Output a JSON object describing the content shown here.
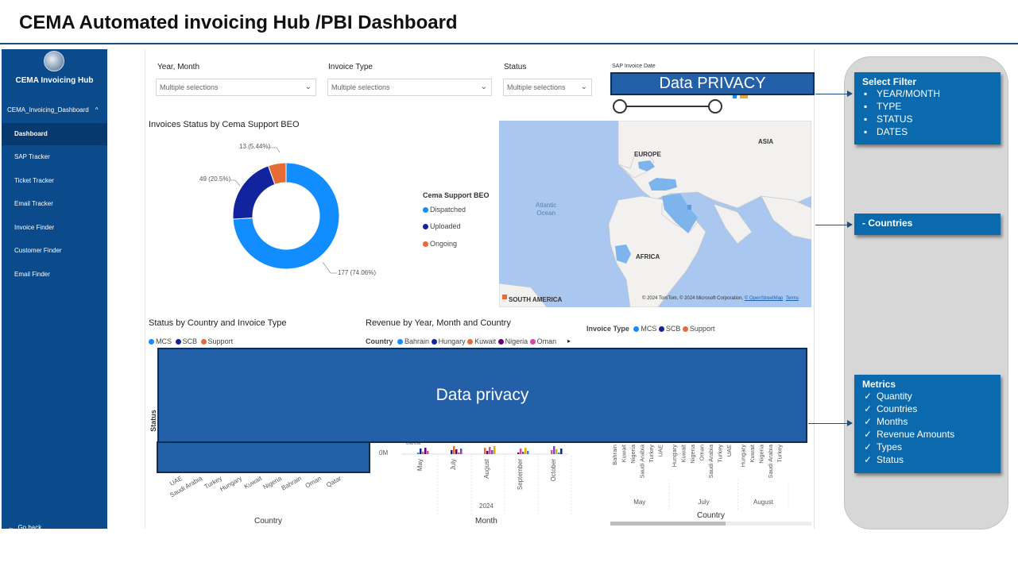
{
  "slide_title": "CEMA Automated invoicing Hub /PBI Dashboard",
  "sidebar": {
    "app_name": "CEMA Invoicing Hub",
    "group_label": "CEMA_Invoicing_Dashboard",
    "items": [
      {
        "label": "Dashboard",
        "active": true
      },
      {
        "label": "SAP Tracker"
      },
      {
        "label": "Ticket Tracker"
      },
      {
        "label": "Email Tracker"
      },
      {
        "label": "Invoice Finder"
      },
      {
        "label": "Customer Finder"
      },
      {
        "label": "Email Finder"
      }
    ],
    "go_back": "Go back"
  },
  "slicers": {
    "year_month": {
      "label": "Year, Month",
      "value": "Multiple selections"
    },
    "invoice_type": {
      "label": "Invoice Type",
      "value": "Multiple selections"
    },
    "status": {
      "label": "Status",
      "value": "Multiple selections"
    },
    "sap_date": {
      "label": "SAP Invoice Date"
    }
  },
  "privacy_top": "Data PRIVACY",
  "privacy_main": "Data privacy",
  "donut": {
    "title": "Invoices Status by Cema Support BEO",
    "legend_title": "Cema Support BEO",
    "labels": [
      "177 (74.06%)",
      "49 (20.5%)",
      "13 (5.44%)"
    ]
  },
  "chart_data": {
    "type": "pie",
    "title": "Invoices Status by Cema Support BEO",
    "legend_title": "Cema Support BEO",
    "categories": [
      "Dispatched",
      "Uploaded",
      "Ongoing"
    ],
    "values": [
      177,
      49,
      13
    ],
    "percent_labels": [
      "74.06%",
      "20.5%",
      "5.44%"
    ],
    "colors": [
      "#118dff",
      "#12239e",
      "#e66c37"
    ],
    "donut": true
  },
  "map": {
    "labels": {
      "europe": "EUROPE",
      "asia": "ASIA",
      "africa": "AFRICA",
      "south_america": "SOUTH AMERICA",
      "atlantic": "Atlantic",
      "ocean": "Ocean"
    },
    "attribution": "© 2024 TomTom, © 2024 Microsoft Corporation,",
    "osm": "© OpenStreetMap",
    "terms": "Terms"
  },
  "status_chart": {
    "title": "Status by Country and Invoice Type",
    "legend": [
      "MCS",
      "SCB",
      "Support"
    ],
    "y_label": "Status",
    "x_label": "Country",
    "countries": [
      "UAE",
      "Saudi Arabia",
      "Turkey",
      "Hungary",
      "Kuwait",
      "Nigeria",
      "Bahrain",
      "Oman",
      "Qatar"
    ]
  },
  "revenue_chart": {
    "title": "Revenue by Year, Month and Country",
    "legend_title": "Country",
    "legend": [
      "Bahrain",
      "Hungary",
      "Kuwait",
      "Nigeria",
      "Oman"
    ],
    "zero_tick": "0M",
    "partial_tick": "0M/0M",
    "months": [
      "May",
      "July",
      "August",
      "September",
      "October"
    ],
    "year": "2024",
    "x_label": "Month"
  },
  "third_chart": {
    "legend_title": "Invoice Type",
    "legend": [
      "MCS",
      "SCB",
      "Support"
    ],
    "groups": [
      {
        "month": "May",
        "countries": [
          "Bahrain",
          "Kuwait",
          "Nigeria",
          "Saudi Arabia",
          "Turkey",
          "UAE"
        ]
      },
      {
        "month": "July",
        "countries": [
          "Hungary",
          "Kuwait",
          "Nigeria",
          "Oman",
          "Saudi Arabia",
          "Turkey",
          "UAE"
        ]
      },
      {
        "month": "August",
        "countries": [
          "Hungary",
          "Kuwait",
          "Nigeria",
          "Saudi Arabia",
          "Turkey"
        ]
      }
    ],
    "x_label": "Country"
  },
  "callouts": {
    "filter": {
      "head": "Select Filter",
      "items": [
        "YEAR/MONTH",
        "TYPE",
        "STATUS",
        "DATES"
      ]
    },
    "countries": {
      "head": "- Countries"
    },
    "metrics": {
      "head": "Metrics",
      "items": [
        "Quantity",
        "Countries",
        "Months",
        "Revenue Amounts",
        "Types",
        "Status"
      ]
    }
  },
  "colors": {
    "sidebar": "#0b4a8b",
    "dispatched": "#118dff",
    "uploaded": "#12239e",
    "ongoing": "#e66c37",
    "privacy": "#2360a8",
    "callout": "#0a6aad"
  }
}
